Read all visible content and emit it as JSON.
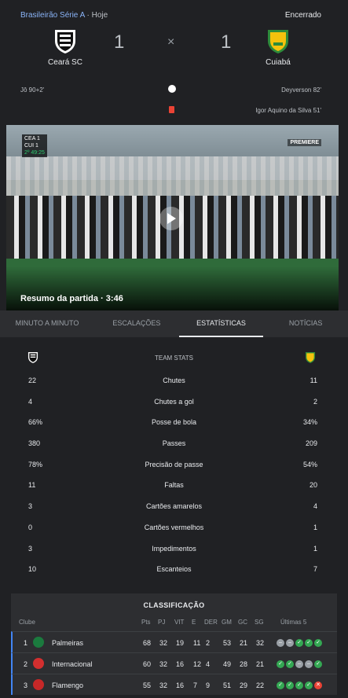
{
  "header": {
    "league": "Brasileirão Série A",
    "date": "· Hoje",
    "status": "Encerrado",
    "home": {
      "name": "Ceará SC",
      "score": "1"
    },
    "away": {
      "name": "Cuiabá",
      "score": "1"
    },
    "separator": "×",
    "events": {
      "home_goal": "Jô 90+2'",
      "away_goal": "Deyverson 82'",
      "away_card": "Igor Aquino da Silva 51'"
    }
  },
  "video": {
    "title": "Resumo da partida · 3:46",
    "scorebug_home": "CEA 1",
    "scorebug_away": "CUI 1",
    "scorebug_time": "2º 49:25",
    "broadcaster": "PREMIERE"
  },
  "tabs": [
    "MINUTO A MINUTO",
    "ESCALAÇÕES",
    "ESTATÍSTICAS",
    "NOTÍCIAS"
  ],
  "stats": {
    "title": "TEAM STATS",
    "rows": [
      {
        "home": "22",
        "name": "Chutes",
        "away": "11"
      },
      {
        "home": "4",
        "name": "Chutes a gol",
        "away": "2"
      },
      {
        "home": "66%",
        "name": "Posse de bola",
        "away": "34%"
      },
      {
        "home": "380",
        "name": "Passes",
        "away": "209"
      },
      {
        "home": "78%",
        "name": "Precisão de passe",
        "away": "54%"
      },
      {
        "home": "11",
        "name": "Faltas",
        "away": "20"
      },
      {
        "home": "3",
        "name": "Cartões amarelos",
        "away": "4"
      },
      {
        "home": "0",
        "name": "Cartões vermelhos",
        "away": "1"
      },
      {
        "home": "3",
        "name": "Impedimentos",
        "away": "1"
      },
      {
        "home": "10",
        "name": "Escanteios",
        "away": "7"
      }
    ]
  },
  "standings": {
    "title": "CLASSIFICAÇÃO",
    "headers": {
      "club": "Clube",
      "pts": "Pts",
      "pj": "PJ",
      "vit": "VIT",
      "e": "E",
      "der": "DER",
      "gm": "GM",
      "gc": "GC",
      "sg": "SG",
      "last": "Últimas 5"
    },
    "rows": [
      {
        "pos": "1",
        "club": "Palmeiras",
        "pts": "68",
        "pj": "32",
        "vit": "19",
        "e": "11",
        "der": "2",
        "gm": "53",
        "gc": "21",
        "sg": "32",
        "color": "#1b7a3e",
        "form": [
          "e",
          "e",
          "v",
          "v",
          "v"
        ]
      },
      {
        "pos": "2",
        "club": "Internacional",
        "pts": "60",
        "pj": "32",
        "vit": "16",
        "e": "12",
        "der": "4",
        "gm": "49",
        "gc": "28",
        "sg": "21",
        "color": "#d32f2f",
        "form": [
          "v",
          "v",
          "e",
          "e",
          "v"
        ]
      },
      {
        "pos": "3",
        "club": "Flamengo",
        "pts": "55",
        "pj": "32",
        "vit": "16",
        "e": "7",
        "der": "9",
        "gm": "51",
        "gc": "29",
        "sg": "22",
        "color": "#c62828",
        "form": [
          "v",
          "v",
          "v",
          "v",
          "d"
        ]
      }
    ]
  }
}
